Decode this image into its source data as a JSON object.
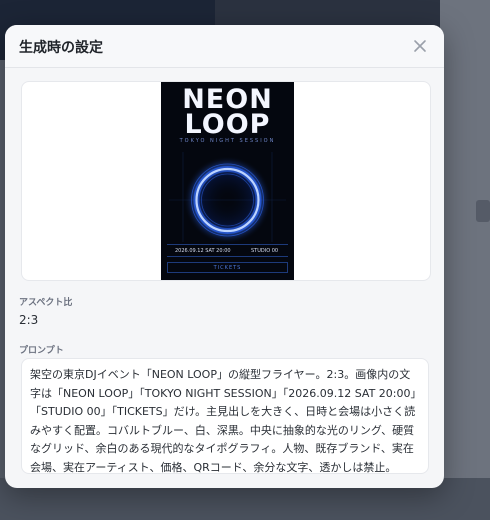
{
  "dialog": {
    "title": "生成時の設定",
    "close_icon": "close-icon"
  },
  "poster": {
    "title_line1": "NEON",
    "title_line2": "LOOP",
    "subtitle": "TOKYO NIGHT SESSION",
    "datetime": "2026.09.12 SAT 20:00",
    "venue": "STUDIO 00",
    "tickets": "TICKETS",
    "colors": {
      "background": "#04070f",
      "ring": "#2f6bff",
      "accent": "#4f79d8"
    }
  },
  "aspect": {
    "label": "アスペクト比",
    "value": "2:3"
  },
  "prompt": {
    "label": "プロンプト",
    "text": "架空の東京DJイベント「NEON LOOP」の縦型フライヤー。2:3。画像内の文字は「NEON LOOP」「TOKYO NIGHT SESSION」「2026.09.12 SAT 20:00」「STUDIO 00」「TICKETS」だけ。主見出しを大きく、日時と会場は小さく読みやすく配置。コバルトブルー、白、深黒。中央に抽象的な光のリング、硬質なグリッド、余白のある現代的なタイポグラフィ。人物、既存ブランド、実在会場、実在アーティスト、価格、QRコード、余分な文字、透かしは禁止。"
  }
}
